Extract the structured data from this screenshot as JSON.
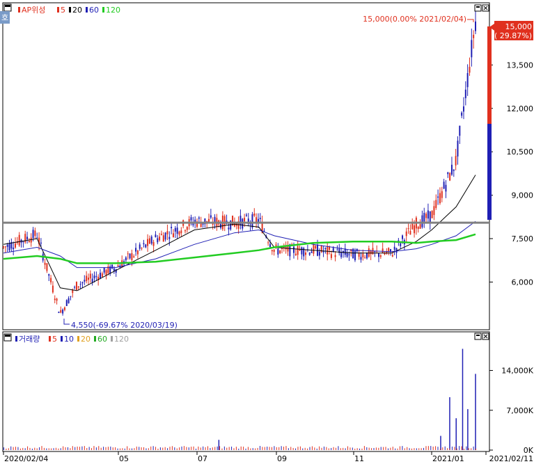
{
  "price_panel": {
    "legend": {
      "name": "AP위성",
      "ma": [
        {
          "label": "5",
          "color": "#e0301e"
        },
        {
          "label": "20",
          "color": "#000000"
        },
        {
          "label": "60",
          "color": "#1f1fb4"
        },
        {
          "label": "120",
          "color": "#22cc22"
        }
      ]
    },
    "hi_annotation": "15,000(0.00% 2021/02/04)",
    "lo_annotation": "4,550(-69.67% 2020/03/19)",
    "current_price": "15,000",
    "current_change": "( 29.87%)",
    "corner_icon": "window-icon"
  },
  "volume_panel": {
    "legend": {
      "name": "거래량",
      "ma": [
        {
          "label": "5",
          "color": "#e0301e"
        },
        {
          "label": "10",
          "color": "#1f1fb4"
        },
        {
          "label": "20",
          "color": "#e0a020"
        },
        {
          "label": "60",
          "color": "#22aa22"
        },
        {
          "label": "120",
          "color": "#a0a0a0"
        }
      ]
    }
  },
  "x_axis": {
    "labels": [
      "2020/02/04",
      "05",
      "07",
      "09",
      "11",
      "2021/01",
      "2021/02/11"
    ]
  },
  "colors": {
    "up": "#e0301e",
    "down": "#1f1fb4",
    "ma5": "#e0301e",
    "ma20": "#000000",
    "ma60": "#1f1fb4",
    "ma120": "#22cc22",
    "hline": "#808080"
  },
  "chart_data": [
    {
      "type": "line",
      "title": "AP위성",
      "y_ticks": [
        "15,000",
        "13,500",
        "12,000",
        "10,500",
        "9,000",
        "7,500",
        "6,000"
      ],
      "y_tick_values": [
        15000,
        13500,
        12000,
        10500,
        9000,
        7500,
        6000
      ],
      "ylim": [
        4400,
        15600
      ],
      "horizontal_line": 8050,
      "x": [
        "2020/02/04",
        "2020/03/01",
        "2020/03/19",
        "2020/04/01",
        "2020/05/01",
        "2020/06/01",
        "2020/07/01",
        "2020/08/01",
        "2020/08/20",
        "2020/09/01",
        "2020/10/01",
        "2020/11/01",
        "2020/12/01",
        "2020/12/20",
        "2021/01/01",
        "2021/01/20",
        "2021/02/04"
      ],
      "series": [
        {
          "name": "5",
          "values": [
            7200,
            7650,
            4900,
            5900,
            6500,
            7500,
            8100,
            8050,
            8150,
            7100,
            7100,
            6950,
            7000,
            8000,
            8300,
            10200,
            15000
          ]
        },
        {
          "name": "20",
          "values": [
            7300,
            7500,
            5800,
            5700,
            6400,
            7100,
            7800,
            8000,
            7900,
            7200,
            7100,
            7000,
            7000,
            7400,
            7800,
            8600,
            9700
          ]
        },
        {
          "name": "60",
          "values": [
            7000,
            7200,
            6900,
            6500,
            6500,
            6800,
            7300,
            7700,
            7800,
            7600,
            7300,
            7100,
            7050,
            7150,
            7300,
            7600,
            8100
          ]
        },
        {
          "name": "120",
          "values": [
            6800,
            6900,
            6800,
            6650,
            6650,
            6700,
            6850,
            7000,
            7100,
            7200,
            7350,
            7400,
            7400,
            7350,
            7400,
            7450,
            7650
          ]
        }
      ]
    },
    {
      "type": "bar",
      "title": "거래량",
      "y_ticks": [
        "14,000K",
        "7,000K",
        "0K"
      ],
      "y_tick_values": [
        14000,
        7000,
        0
      ],
      "ylim": [
        0,
        19200
      ],
      "unit": "K",
      "x": [
        "2020/07/20",
        "2021/01/08",
        "2021/01/15",
        "2021/01/20",
        "2021/01/25",
        "2021/01/29",
        "2021/02/04"
      ],
      "values": [
        1800,
        2500,
        9300,
        5600,
        17800,
        7200,
        13400
      ]
    }
  ]
}
